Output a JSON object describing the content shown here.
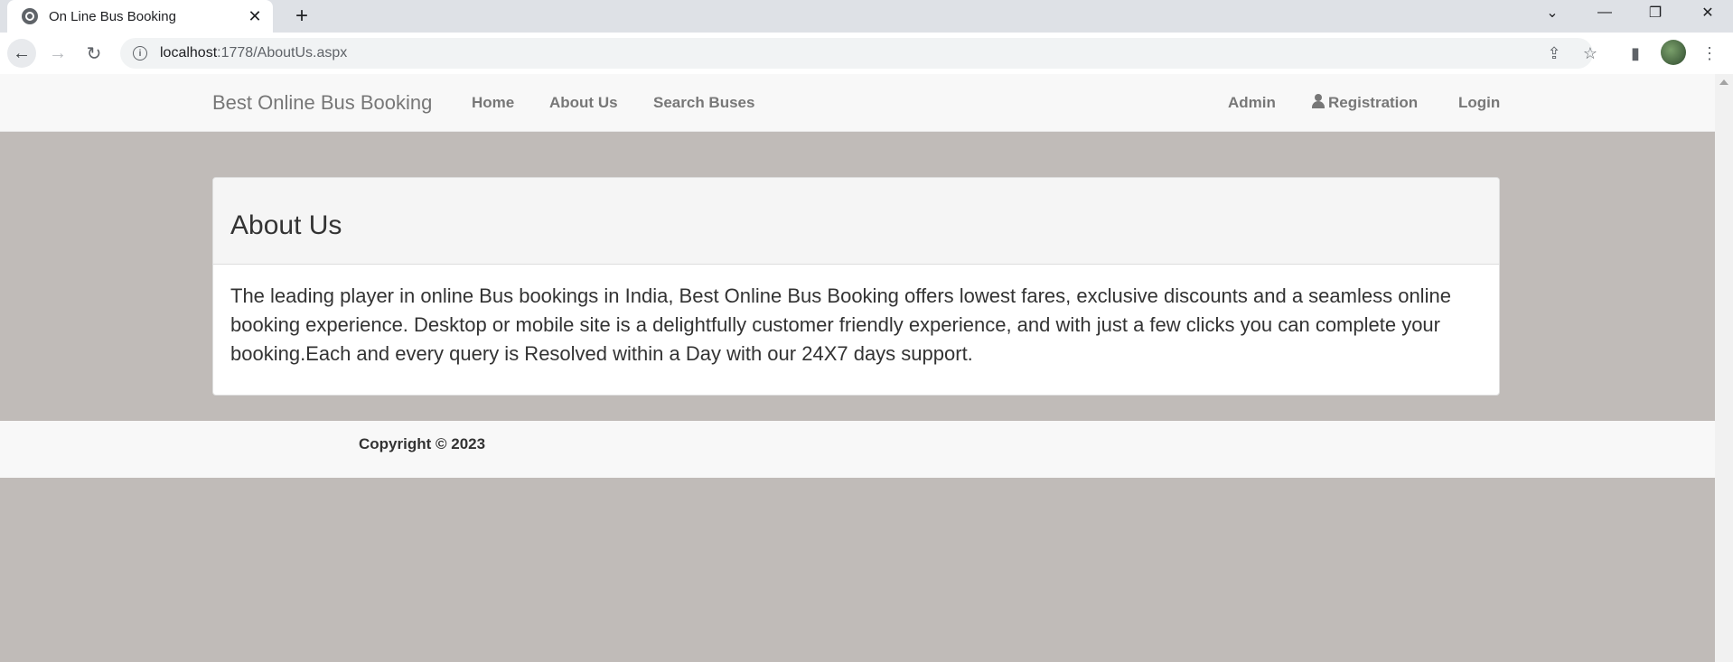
{
  "browser": {
    "tab_title": "On Line Bus Booking",
    "tab_close": "✕",
    "new_tab": "+",
    "url_host": "localhost",
    "url_path": ":1778/AboutUs.aspx",
    "icons": [
      "globe-icon",
      "back-icon",
      "forward-icon",
      "reload-icon",
      "info-icon",
      "share-icon",
      "star-icon",
      "sidepanel-icon",
      "menu-icon"
    ]
  },
  "navbar": {
    "brand": "Best Online Bus Booking",
    "left_links": [
      "Home",
      "About Us",
      "Search Buses"
    ],
    "admin": "Admin",
    "registration": "Registration",
    "login": "Login"
  },
  "panel": {
    "heading": "About Us",
    "body": "The leading player in online Bus bookings in India, Best Online Bus Booking offers lowest fares, exclusive discounts and a seamless online booking experience. Desktop or mobile site is a delightfully customer friendly experience, and with just a few clicks you can complete your booking.Each and every query is Resolved within a Day with our 24X7 days support."
  },
  "footer": {
    "copyright": "Copyright © 2023"
  },
  "colors": {
    "page_bg": "#c0bbb8",
    "navbar_bg": "#f8f8f8",
    "link": "#777777",
    "text": "#333333"
  }
}
